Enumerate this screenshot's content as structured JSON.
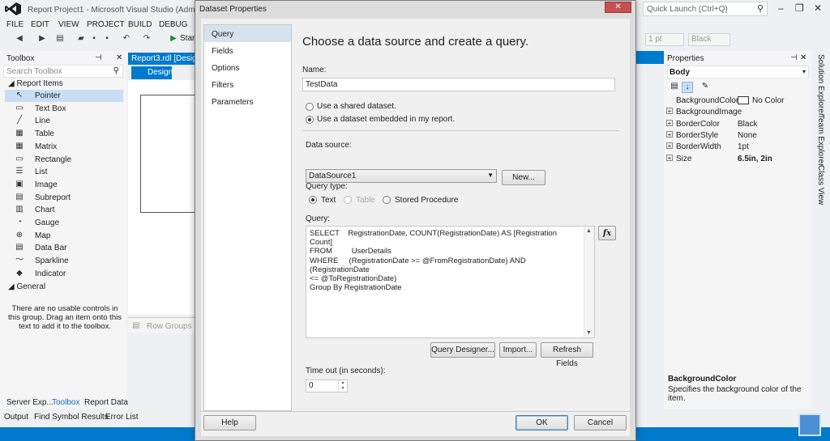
{
  "vs": {
    "title": "Report Project1 - Microsoft Visual Studio (Administ",
    "quick_launch_placeholder": "Quick Launch (Ctrl+Q)",
    "menus": [
      "FILE",
      "EDIT",
      "VIEW",
      "PROJECT",
      "BUILD",
      "DEBUG"
    ],
    "start_label": "Star",
    "font_size_combo": "1 pt",
    "color_combo": "Black",
    "doc_tab": "Report3.rdl [Design",
    "design_tab": "Design",
    "row_groups": "Row Groups"
  },
  "toolbox": {
    "title": "Toolbox",
    "search_placeholder": "Search Toolbox",
    "group_report_items": "Report Items",
    "items": [
      {
        "label": "Pointer",
        "icon": "pointer-icon",
        "glyph": "↖"
      },
      {
        "label": "Text Box",
        "icon": "textbox-icon",
        "glyph": "▭"
      },
      {
        "label": "Line",
        "icon": "line-icon",
        "glyph": "╱"
      },
      {
        "label": "Table",
        "icon": "table-icon",
        "glyph": "▦"
      },
      {
        "label": "Matrix",
        "icon": "matrix-icon",
        "glyph": "▦"
      },
      {
        "label": "Rectangle",
        "icon": "rectangle-icon",
        "glyph": "▭"
      },
      {
        "label": "List",
        "icon": "list-icon",
        "glyph": "☰"
      },
      {
        "label": "Image",
        "icon": "image-icon",
        "glyph": "▣"
      },
      {
        "label": "Subreport",
        "icon": "subreport-icon",
        "glyph": "▤"
      },
      {
        "label": "Chart",
        "icon": "chart-icon",
        "glyph": "▥"
      },
      {
        "label": "Gauge",
        "icon": "gauge-icon",
        "glyph": "◔"
      },
      {
        "label": "Map",
        "icon": "map-icon",
        "glyph": "⊕"
      },
      {
        "label": "Data Bar",
        "icon": "databar-icon",
        "glyph": "▤"
      },
      {
        "label": "Sparkline",
        "icon": "sparkline-icon",
        "glyph": "〜"
      },
      {
        "label": "Indicator",
        "icon": "indicator-icon",
        "glyph": "◆"
      }
    ],
    "group_general": "General",
    "empty_message": "There are no usable controls in this group. Drag an item onto this text to add it to the toolbox.",
    "bottom_tabs": [
      "Server Exp...",
      "Toolbox",
      "Report Data"
    ],
    "output_tabs": [
      "Output",
      "Find Symbol Results",
      "Error List"
    ]
  },
  "properties": {
    "title": "Properties",
    "object": "Body",
    "rows": [
      {
        "name": "BackgroundColor",
        "value": "No Color",
        "expand": false,
        "swatch": true,
        "bold": false
      },
      {
        "name": "BackgroundImage",
        "value": "",
        "expand": true,
        "swatch": false,
        "bold": false
      },
      {
        "name": "BorderColor",
        "value": "Black",
        "expand": true,
        "swatch": false,
        "bold": false
      },
      {
        "name": "BorderStyle",
        "value": "None",
        "expand": true,
        "swatch": false,
        "bold": false
      },
      {
        "name": "BorderWidth",
        "value": "1pt",
        "expand": true,
        "swatch": false,
        "bold": false
      },
      {
        "name": "Size",
        "value": "6.5in, 2in",
        "expand": true,
        "swatch": false,
        "bold": true
      }
    ],
    "desc_name": "BackgroundColor",
    "desc_text": "Specifies the background color of the item.",
    "side_tabs": [
      "Solution Explorer",
      "Team Explorer",
      "Class View"
    ]
  },
  "dialog": {
    "title": "Dataset Properties",
    "nav": [
      "Query",
      "Fields",
      "Options",
      "Filters",
      "Parameters"
    ],
    "heading": "Choose a data source and create a query.",
    "name_label": "Name:",
    "name_value": "TestData",
    "radio_shared": "Use a shared dataset.",
    "radio_embedded": "Use a dataset embedded in my report.",
    "datasource_label": "Data source:",
    "datasource_value": "DataSource1",
    "new_button": "New...",
    "query_type_label": "Query type:",
    "qt_text": "Text",
    "qt_table": "Table",
    "qt_stored": "Stored Procedure",
    "query_label": "Query:",
    "query_text": "SELECT    RegistrationDate, COUNT(RegistrationDate) AS [Registration Count]\nFROM         UserDetails\nWHERE     (RegistrationDate >= @FromRegistrationDate) AND (RegistrationDate\n<= @ToRegistrationDate)\nGroup By RegistrationDate",
    "fx_label": "fx",
    "query_designer_button": "Query Designer...",
    "import_button": "Import...",
    "refresh_fields_button": "Refresh Fields",
    "timeout_label": "Time out (in seconds):",
    "timeout_value": "0",
    "help_button": "Help",
    "ok_button": "OK",
    "cancel_button": "Cancel"
  },
  "colors": {
    "accent": "#007acc",
    "nav_selected": "#d6e2ee",
    "close_button": "#c75050"
  }
}
